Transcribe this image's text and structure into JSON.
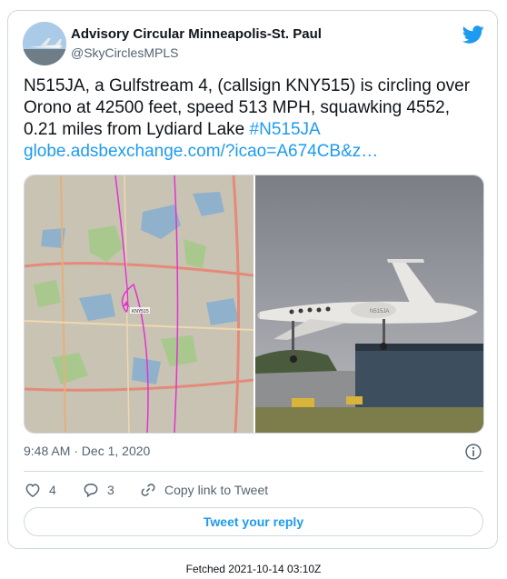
{
  "tweet": {
    "author_name": "Advisory Circular Minneapolis-St. Paul",
    "author_handle": "@SkyCirclesMPLS",
    "text_plain": "N515JA, a Gulfstream 4, (callsign KNY515) is circling over Orono at 42500 feet, speed 513 MPH, squawking 4552, 0.21 miles from Lydiard Lake ",
    "hashtag": "#N515JA",
    "url": "globe.adsbexchange.com/?icao=A674CB&z…",
    "timestamp": "9:48 AM · Dec 1, 2020",
    "likes": "4",
    "replies": "3",
    "copy_link_label": "Copy link to Tweet",
    "reply_button_label": "Tweet your reply"
  },
  "media": {
    "map_label": "KNY515",
    "aircraft_tail_number": "N515JA"
  },
  "footer": {
    "fetched": "Fetched 2021-10-14 03:10Z"
  },
  "colors": {
    "accent": "#1d9bf0",
    "border": "#cfd9de",
    "secondary_text": "#536471",
    "flight_track": "#e033d0"
  },
  "icons": [
    "twitter-bird-icon",
    "info-icon",
    "heart-icon",
    "reply-icon",
    "link-icon"
  ]
}
